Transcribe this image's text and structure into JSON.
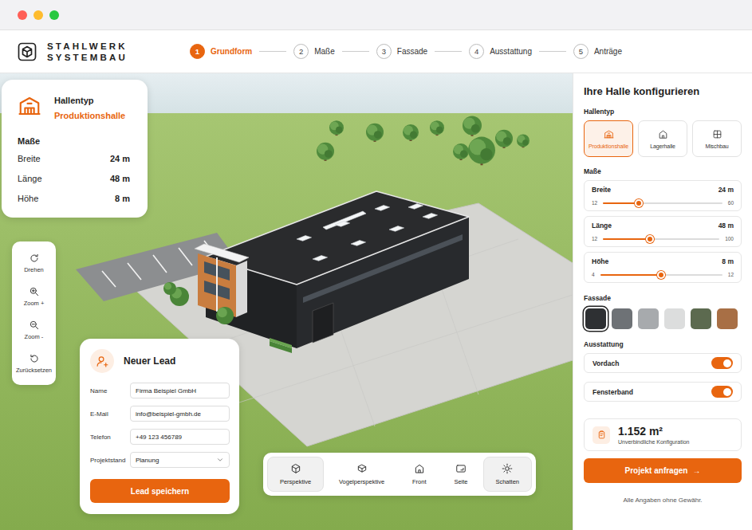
{
  "brand": {
    "line1": "STAHLWERK",
    "line2": "SYSTEMBAU"
  },
  "steps": [
    {
      "number": "1",
      "label": "Grundform",
      "selected": true
    },
    {
      "number": "2",
      "label": "Maße",
      "selected": false
    },
    {
      "number": "3",
      "label": "Fassade",
      "selected": false
    },
    {
      "number": "4",
      "label": "Ausstattung",
      "selected": false
    },
    {
      "number": "5",
      "label": "Anträge",
      "selected": false
    }
  ],
  "info": {
    "title": "Hallentyp",
    "value": "Produktionshalle",
    "dims_title": "Maße",
    "dims": [
      {
        "label": "Breite",
        "value": "24 m"
      },
      {
        "label": "Länge",
        "value": "48 m"
      },
      {
        "label": "Höhe",
        "value": "8 m"
      }
    ]
  },
  "tools": [
    {
      "label": "Drehen"
    },
    {
      "label": "Zoom +"
    },
    {
      "label": "Zoom -"
    },
    {
      "label": "Zurücksetzen"
    }
  ],
  "lead": {
    "title": "Neuer Lead",
    "fields": [
      {
        "label": "Name",
        "value": "Firma Beispiel GmbH",
        "kind": "input"
      },
      {
        "label": "E-Mail",
        "value": "info@beispiel-gmbh.de",
        "kind": "input"
      },
      {
        "label": "Telefon",
        "value": "+49 123 456789",
        "kind": "input"
      },
      {
        "label": "Projektstand",
        "value": "Planung",
        "kind": "select"
      }
    ],
    "button": "Lead speichern"
  },
  "views": [
    {
      "label": "Perspektive",
      "selected": true
    },
    {
      "label": "Vogelperspektive",
      "selected": false
    },
    {
      "label": "Front",
      "selected": false
    },
    {
      "label": "Seite",
      "selected": false
    }
  ],
  "shadow": {
    "label": "Schatten",
    "on": true
  },
  "sidebar": {
    "title": "Ihre Halle konfigurieren",
    "hall_type_label": "Hallentyp",
    "hall_types": [
      {
        "label": "Produktionshalle",
        "selected": true
      },
      {
        "label": "Lagerhalle",
        "selected": false
      },
      {
        "label": "Mischbau",
        "selected": false
      }
    ],
    "dims_label": "Maße",
    "sliders": [
      {
        "label": "Breite",
        "reading": "24 m",
        "min": "12",
        "max": "60",
        "level": 0.3
      },
      {
        "label": "Länge",
        "reading": "48 m",
        "min": "12",
        "max": "100",
        "level": 0.4
      },
      {
        "label": "Höhe",
        "reading": "8 m",
        "min": "4",
        "max": "12",
        "level": 0.5
      }
    ],
    "facade_label": "Fassade",
    "facades": [
      {
        "color": "#2e3033",
        "selected": true
      },
      {
        "color": "#6e7276",
        "selected": false
      },
      {
        "color": "#a7aaad",
        "selected": false
      },
      {
        "color": "#dcdddd",
        "selected": false
      },
      {
        "color": "#5c6a4f",
        "selected": false
      },
      {
        "color": "#a86f45",
        "selected": false
      }
    ],
    "equipment_label": "Ausstattung",
    "toggles": [
      {
        "label": "Vordach",
        "on": true
      },
      {
        "label": "Fensterband",
        "on": true
      }
    ],
    "summary": {
      "area": "1.152 m²",
      "note": "Unverbindliche Konfiguration"
    },
    "cta": {
      "label": "Projekt anfragen",
      "icon": "→"
    },
    "disclaimer": "Alle Angaben ohne Gewähr."
  }
}
